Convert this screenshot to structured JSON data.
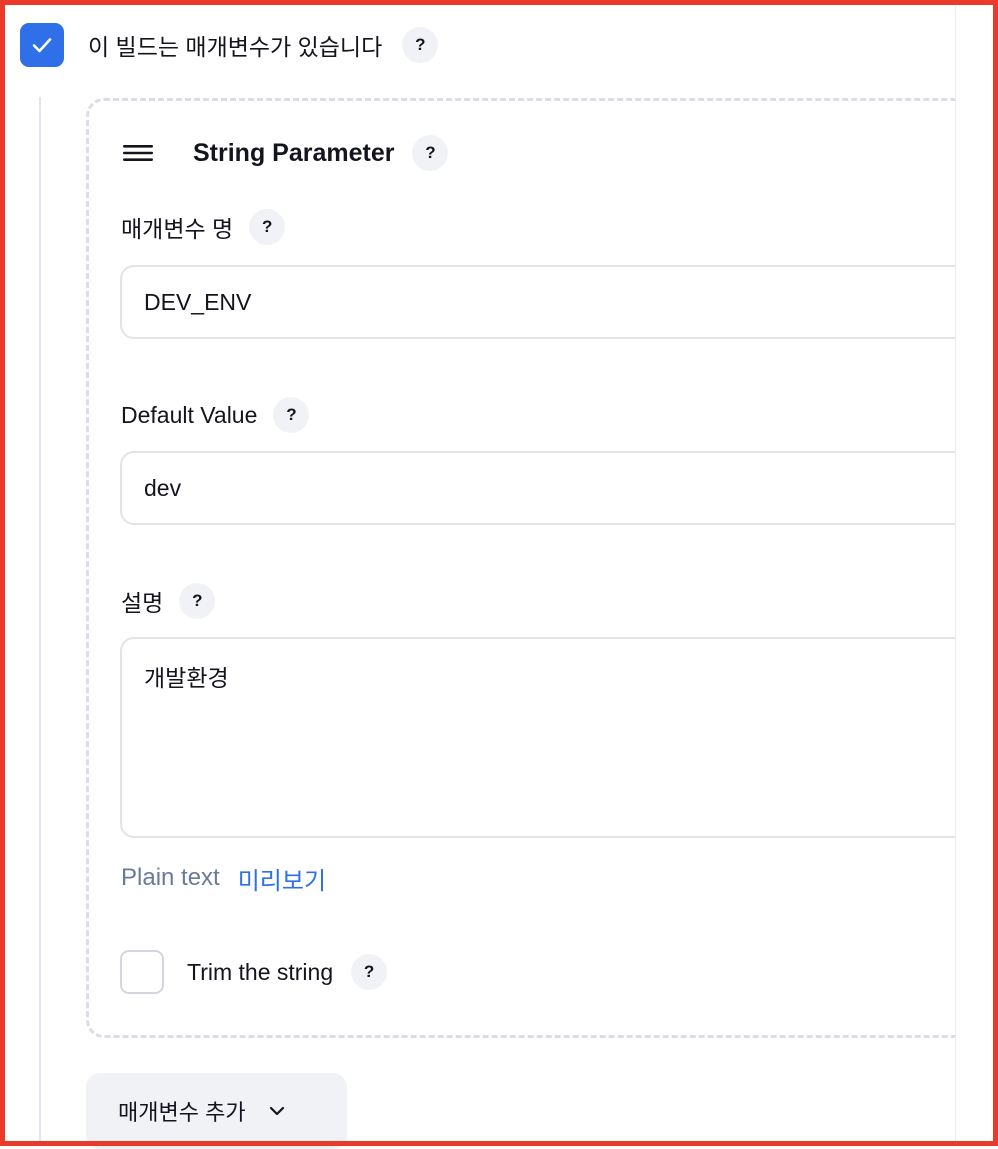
{
  "params_toggle": {
    "label": "이 빌드는 매개변수가 있습니다",
    "checked": true,
    "help": "?"
  },
  "parameter": {
    "title": "String Parameter",
    "help": "?",
    "name_field": {
      "label": "매개변수 명",
      "help": "?",
      "value": "DEV_ENV"
    },
    "default_field": {
      "label": "Default Value",
      "help": "?",
      "value": "dev"
    },
    "description_field": {
      "label": "설명",
      "help": "?",
      "value": "개발환경"
    },
    "format": {
      "plain": "Plain text",
      "preview": "미리보기"
    },
    "trim": {
      "label": "Trim the string",
      "help": "?",
      "checked": false
    }
  },
  "add_button": {
    "label": "매개변수 추가"
  },
  "colors": {
    "accent": "#2f6fe8",
    "frame": "#ea3a2a"
  }
}
